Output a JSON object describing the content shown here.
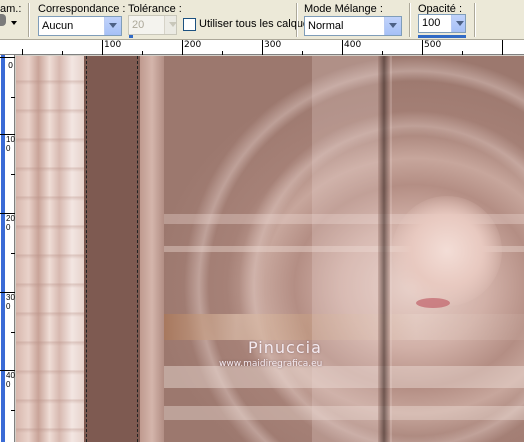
{
  "toolbar": {
    "partial_left_label": "am.:",
    "match_label": "Correspondance :",
    "match_value": "Aucun",
    "tolerance_label": "Tolérance :",
    "tolerance_value": "20",
    "all_layers_label": "Utiliser tous les calques",
    "blend_label": "Mode Mélange :",
    "blend_value": "Normal",
    "opacity_label": "Opacité :",
    "opacity_value": "100"
  },
  "ruler": {
    "top_labels": [
      "100",
      "200",
      "300",
      "400",
      "500"
    ],
    "left_labels": [
      "0",
      "100",
      "200",
      "300",
      "400"
    ]
  },
  "canvas": {
    "watermark_title": "Pinuccia",
    "watermark_url": "www.maidiregrafica.eu"
  },
  "colors": {
    "background": "#a88479",
    "stripe": "#7e5a51",
    "highlight": "#f0dcd6"
  }
}
